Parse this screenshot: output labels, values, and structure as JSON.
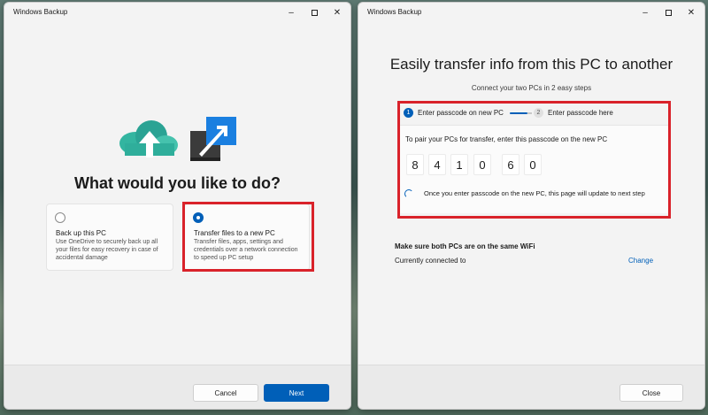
{
  "left_window": {
    "title": "Windows Backup",
    "question": "What would you like to do?",
    "options": [
      {
        "title": "Back up this PC",
        "description": "Use OneDrive to securely back up all your files for easy recovery in case of accidental damage",
        "selected": false
      },
      {
        "title": "Transfer files to a new PC",
        "description": "Transfer files, apps, settings and credentials over a network connection to speed up PC setup",
        "selected": true
      }
    ],
    "buttons": {
      "cancel": "Cancel",
      "next": "Next"
    }
  },
  "right_window": {
    "title": "Windows Backup",
    "heading": "Easily transfer info from this PC to another",
    "subheading": "Connect your two PCs in 2 easy steps",
    "steps": [
      {
        "number": "1",
        "label": "Enter passcode on new PC",
        "active": true
      },
      {
        "number": "2",
        "label": "Enter passcode here",
        "active": false
      }
    ],
    "pair_instruction": "To pair your PCs for transfer, enter this passcode on the new PC",
    "passcode": [
      "8",
      "4",
      "1",
      "0",
      "6",
      "0"
    ],
    "waiting_text": "Once you enter passcode on the new PC, this page will update to next step",
    "wifi": {
      "title": "Make sure both PCs are on the same WiFi",
      "current_label": "Currently connected to",
      "change_link": "Change"
    },
    "buttons": {
      "close": "Close"
    }
  },
  "caption_icons": {
    "minimize": "minimize-icon",
    "maximize": "maximize-icon",
    "close": "close-icon"
  },
  "colors": {
    "accent": "#005fb8",
    "highlight": "#d9222a",
    "cloud": "#33b5a0",
    "dark_tile": "#3b3b3b",
    "blue_tile": "#1a7fe0"
  }
}
